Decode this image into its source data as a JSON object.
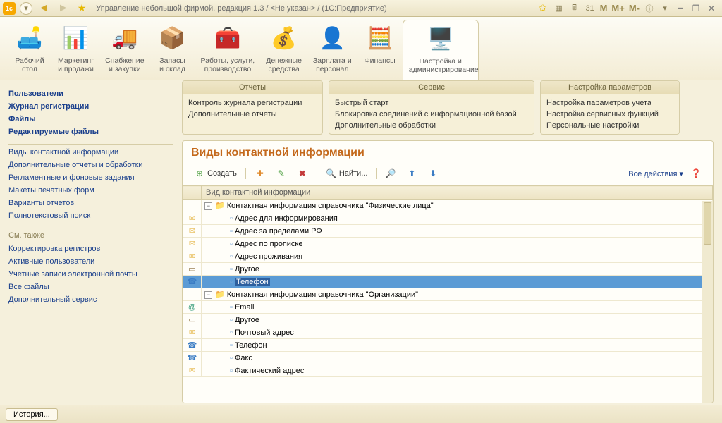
{
  "titlebar": {
    "title": "Управление небольшой фирмой, редакция 1.3 / <Не указан> / (1С:Предприятие)",
    "memory_buttons": [
      "M",
      "M+",
      "M-"
    ]
  },
  "ribbon": [
    {
      "icon": "🛋️",
      "label": "Рабочий\nстол"
    },
    {
      "icon": "📊",
      "label": "Маркетинг\nи продажи"
    },
    {
      "icon": "🚚",
      "label": "Снабжение\nи закупки"
    },
    {
      "icon": "📦",
      "label": "Запасы\nи склад"
    },
    {
      "icon": "🧰",
      "label": "Работы, услуги,\nпроизводство"
    },
    {
      "icon": "💰",
      "label": "Денежные\nсредства"
    },
    {
      "icon": "👤",
      "label": "Зарплата и\nперсонал"
    },
    {
      "icon": "🧮",
      "label": "Финансы"
    },
    {
      "icon": "🖥️",
      "label": "Настройка и\nадминистрирование",
      "active": true
    }
  ],
  "panels": {
    "reports": {
      "title": "Отчеты",
      "items": [
        "Контроль журнала регистрации",
        "Дополнительные отчеты"
      ]
    },
    "service": {
      "title": "Сервис",
      "items": [
        "Быстрый старт",
        "Блокировка соединений с информационной базой",
        "Дополнительные обработки"
      ]
    },
    "settings": {
      "title": "Настройка параметров",
      "items": [
        "Настройка параметров учета",
        "Настройка сервисных функций",
        "Персональные настройки"
      ]
    }
  },
  "sidebar": {
    "main": [
      {
        "label": "Пользователи",
        "bold": true
      },
      {
        "label": "Журнал регистрации",
        "bold": true
      },
      {
        "label": "Файлы",
        "bold": true
      },
      {
        "label": "Редактируемые файлы",
        "bold": true
      }
    ],
    "group2": [
      "Виды контактной информации",
      "Дополнительные отчеты и обработки",
      "Регламентные и фоновые задания",
      "Макеты печатных форм",
      "Варианты отчетов",
      "Полнотекстовый поиск"
    ],
    "see_also_label": "См. также",
    "see_also": [
      "Корректировка регистров",
      "Активные пользователи",
      "Учетные записи электронной почты",
      "Все файлы",
      "Дополнительный сервис"
    ]
  },
  "form": {
    "title": "Виды контактной информации",
    "toolbar": {
      "create": "Создать",
      "find": "Найти...",
      "all_actions": "Все действия"
    },
    "header_col": "Вид контактной информации",
    "rows": [
      {
        "icon": "",
        "indent": 0,
        "expander": "-",
        "folder": true,
        "text": "Контактная информация справочника \"Физические лица\""
      },
      {
        "icon": "envelope",
        "indent": 2,
        "leaf": true,
        "text": "Адрес для информирования"
      },
      {
        "icon": "envelope",
        "indent": 2,
        "leaf": true,
        "text": "Адрес за пределами РФ"
      },
      {
        "icon": "envelope",
        "indent": 2,
        "leaf": true,
        "text": "Адрес по прописке"
      },
      {
        "icon": "envelope",
        "indent": 2,
        "leaf": true,
        "text": "Адрес проживания"
      },
      {
        "icon": "card",
        "indent": 2,
        "leaf": true,
        "text": "Другое"
      },
      {
        "icon": "phone",
        "indent": 2,
        "leaf": true,
        "text": "Телефон",
        "selected": true
      },
      {
        "icon": "",
        "indent": 0,
        "expander": "-",
        "folder": true,
        "text": "Контактная информация справочника \"Организации\""
      },
      {
        "icon": "at",
        "indent": 2,
        "leaf": true,
        "text": "Email"
      },
      {
        "icon": "card",
        "indent": 2,
        "leaf": true,
        "text": "Другое"
      },
      {
        "icon": "envelope",
        "indent": 2,
        "leaf": true,
        "text": "Почтовый адрес"
      },
      {
        "icon": "phone",
        "indent": 2,
        "leaf": true,
        "text": "Телефон"
      },
      {
        "icon": "phone",
        "indent": 2,
        "leaf": true,
        "text": "Факс"
      },
      {
        "icon": "envelope",
        "indent": 2,
        "leaf": true,
        "text": "Фактический адрес"
      }
    ]
  },
  "statusbar": {
    "history": "История..."
  }
}
